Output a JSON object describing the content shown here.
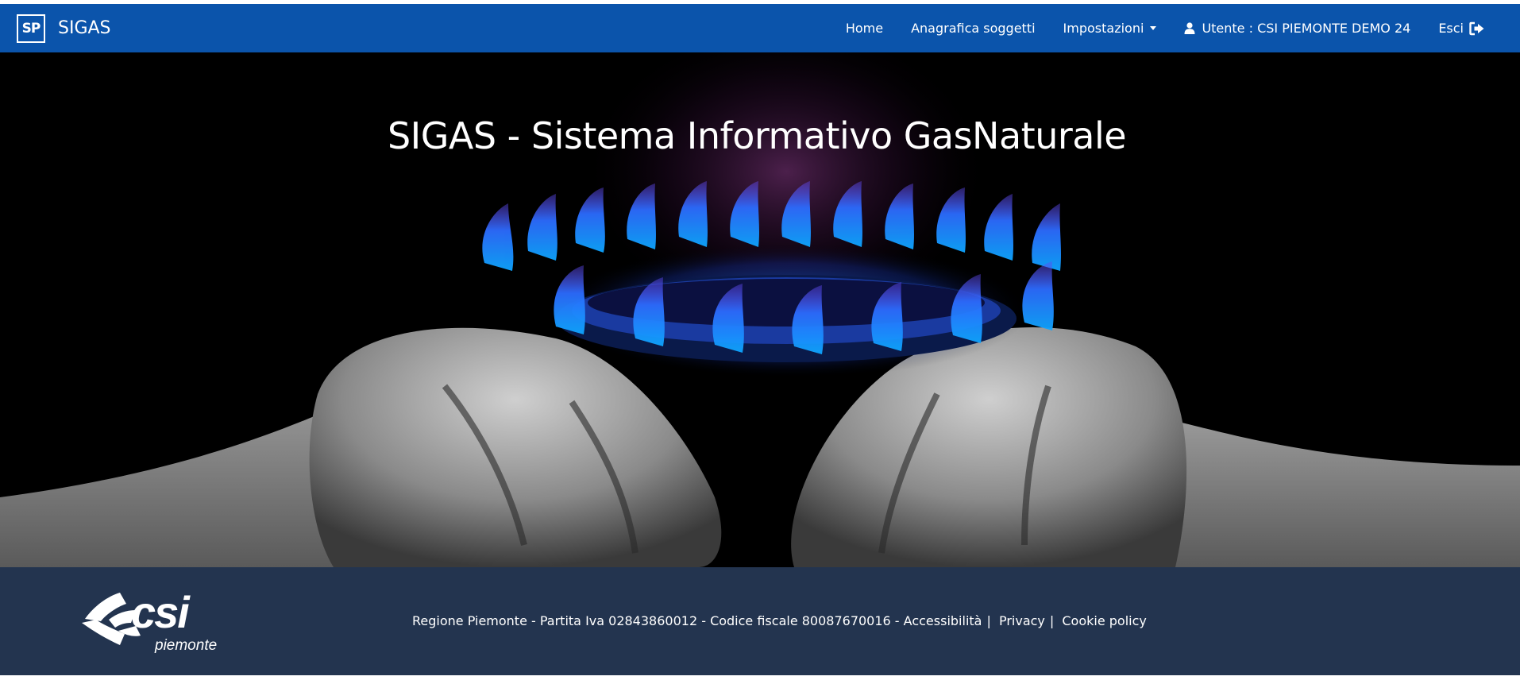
{
  "navbar": {
    "logo_text": "SP",
    "app_name": "SIGAS",
    "links": {
      "home": "Home",
      "anagrafica": "Anagrafica soggetti",
      "impostazioni": "Impostazioni",
      "utente": "Utente : CSI PIEMONTE DEMO 24",
      "esci": "Esci"
    },
    "icons": {
      "user": "user-icon",
      "exit": "sign-out-icon",
      "dropdown": "caret-down-icon"
    },
    "background_color": "#0b54ab"
  },
  "hero": {
    "title": "SIGAS - Sistema Informativo GasNaturale",
    "image": "gas-burner-flame-in-hands"
  },
  "footer": {
    "logo_text": "csi",
    "logo_subtext": "piemonte",
    "info_text": "Regione Piemonte - Partita Iva 02843860012 - Codice fiscale 80087670016 -",
    "links": {
      "accessibilita": "Accessibilità",
      "privacy": "Privacy",
      "cookie": "Cookie policy"
    },
    "separator": "|",
    "background_color": "#23344f"
  }
}
